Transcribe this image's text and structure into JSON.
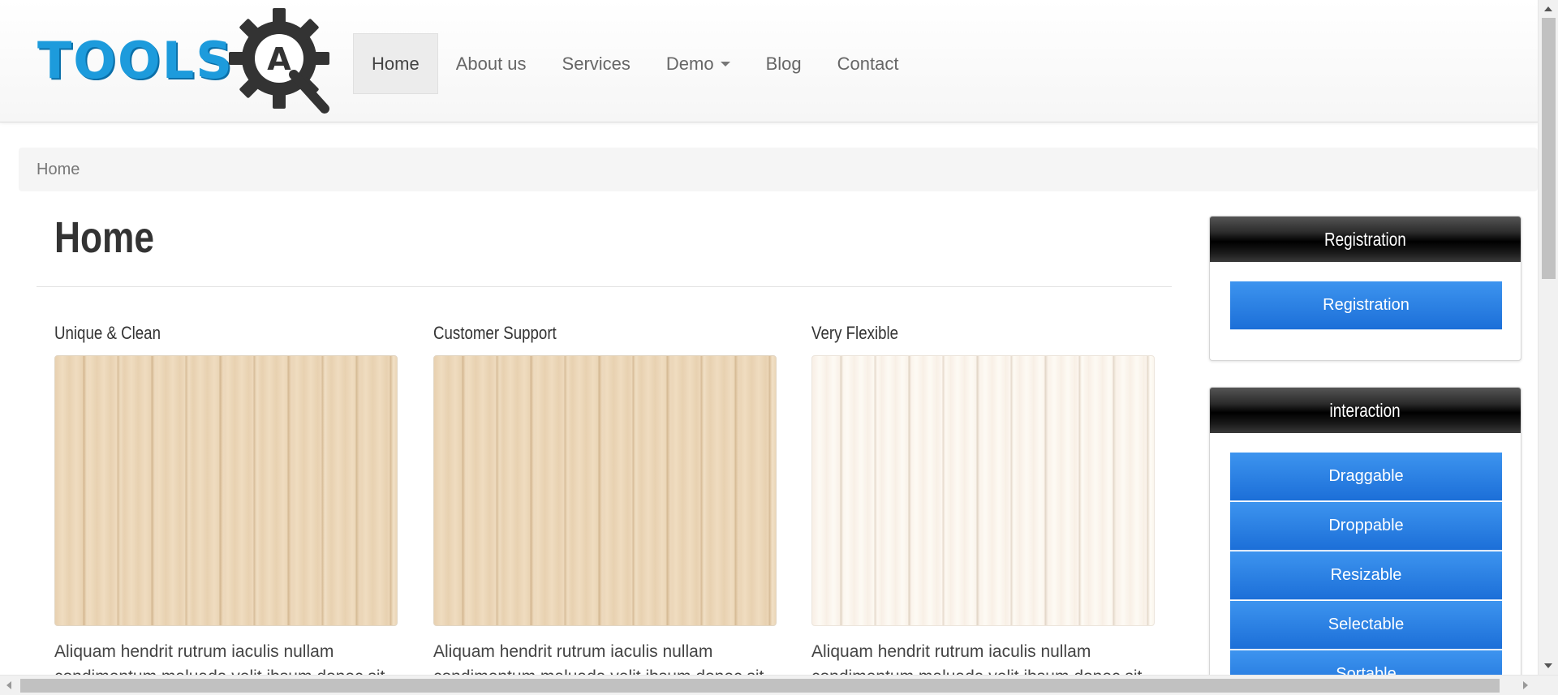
{
  "header": {
    "logo_text": "TOOLS",
    "logo_badge": "A",
    "nav": [
      {
        "label": "Home"
      },
      {
        "label": "About us"
      },
      {
        "label": "Services"
      },
      {
        "label": "Demo"
      },
      {
        "label": "Blog"
      },
      {
        "label": "Contact"
      }
    ]
  },
  "breadcrumb": {
    "current": "Home"
  },
  "main": {
    "title": "Home",
    "features": [
      {
        "heading": "Unique & Clean",
        "text": "Aliquam hendrit rutrum iaculis nullam condimentum maluada velit ibsum donec sit"
      },
      {
        "heading": "Customer Support",
        "text": "Aliquam hendrit rutrum iaculis nullam condimentum maluada velit ibsum donec sit"
      },
      {
        "heading": "Very Flexible",
        "text": "Aliquam hendrit rutrum iaculis nullam condimentum maluada velit ibsum donec sit"
      }
    ]
  },
  "sidebar": {
    "registration": {
      "title": "Registration",
      "buttons": [
        {
          "label": "Registration"
        }
      ]
    },
    "interaction": {
      "title": "interaction",
      "buttons": [
        {
          "label": "Draggable"
        },
        {
          "label": "Droppable"
        },
        {
          "label": "Resizable"
        },
        {
          "label": "Selectable"
        },
        {
          "label": "Sortable"
        }
      ]
    }
  },
  "colors": {
    "logo_blue": "#1d9bdc",
    "button_blue": "#2a80e4",
    "widget_header": "#111111"
  },
  "icons": {
    "logo": "gear-icon",
    "demo_dropdown": "caret-down-icon"
  }
}
